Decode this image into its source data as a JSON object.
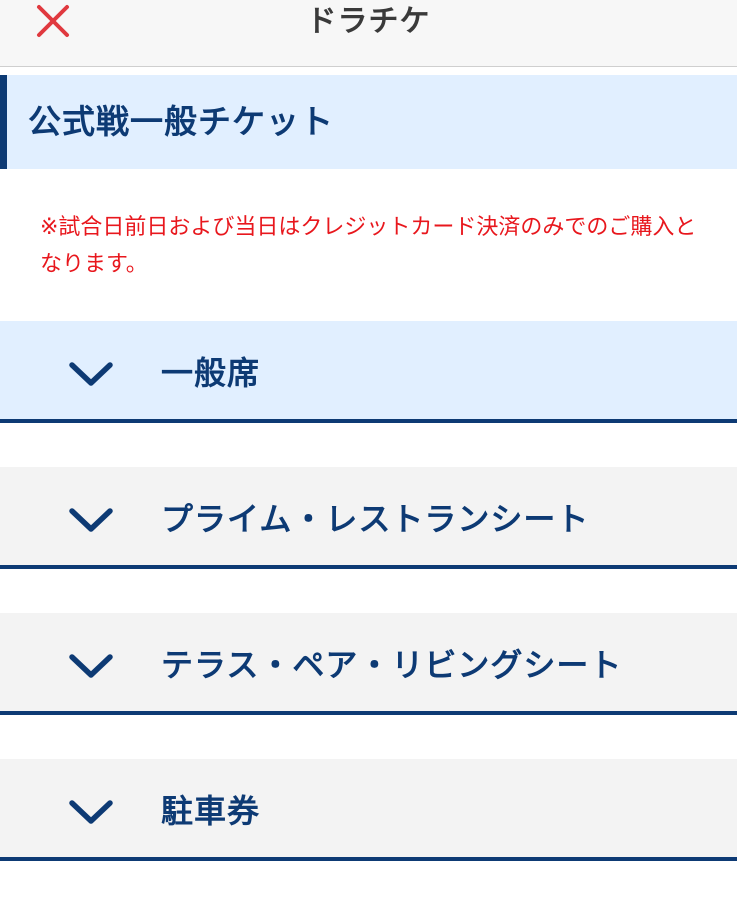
{
  "header": {
    "title": "ドラチケ",
    "close_icon": "close-icon",
    "close_color": "#e0393f"
  },
  "section": {
    "title": "公式戦一般チケット"
  },
  "notice": {
    "text": "※試合日前日および当日はクレジットカード決済のみでのご購入となります。"
  },
  "accordion": {
    "items": [
      {
        "label": "一般席",
        "icon": "chevron-down-icon",
        "state": "open"
      },
      {
        "label": "プライム・レストランシート",
        "icon": "chevron-down-icon",
        "state": "closed"
      },
      {
        "label": "テラス・ペア・リビングシート",
        "icon": "chevron-down-icon",
        "state": "closed"
      },
      {
        "label": "駐車券",
        "icon": "chevron-down-icon",
        "state": "closed"
      }
    ]
  },
  "colors": {
    "brand_navy": "#0d3a74",
    "highlight_bg": "#e1efff",
    "notice_red": "#e8171d"
  }
}
